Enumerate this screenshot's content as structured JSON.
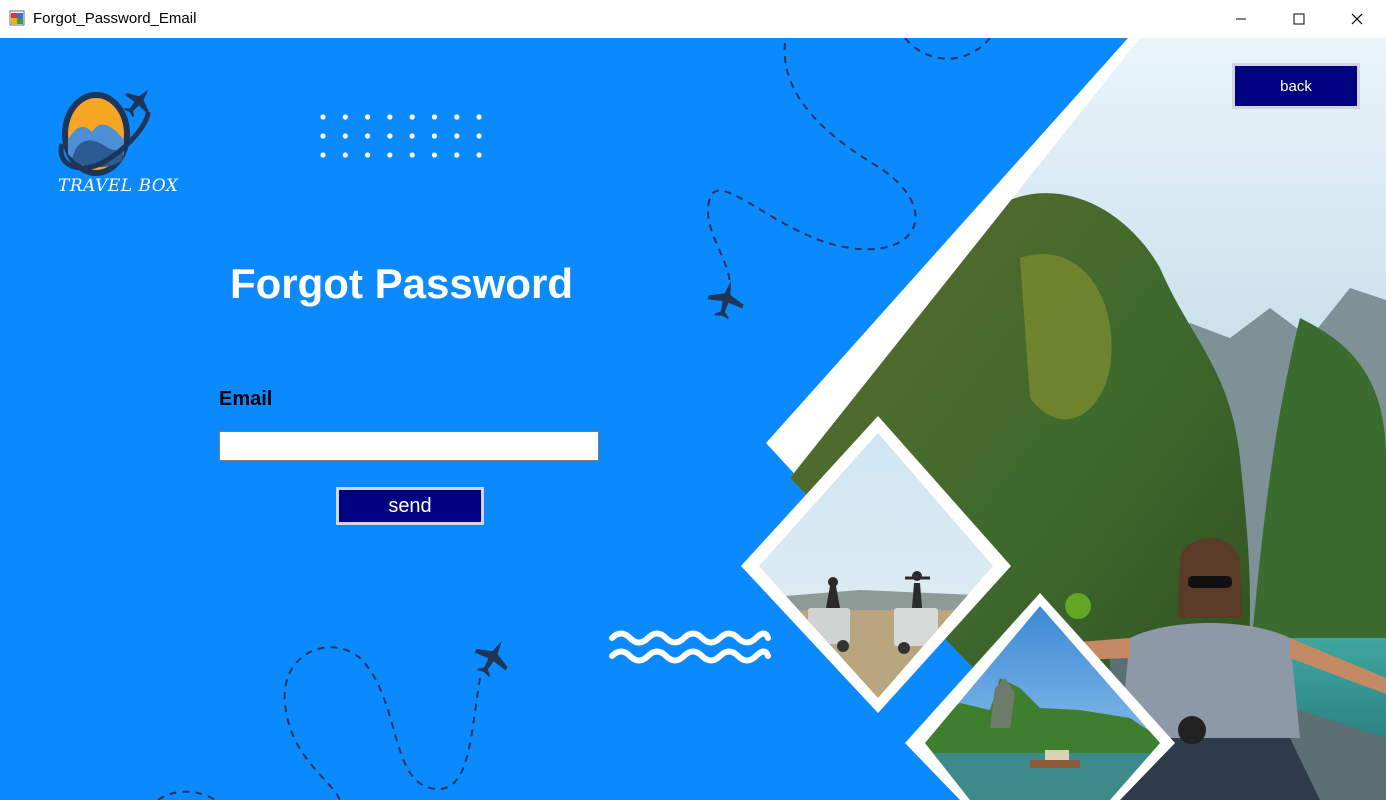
{
  "window": {
    "title": "Forgot_Password_Email",
    "app_icon": "winforms-app-icon",
    "controls": [
      "minimize-icon",
      "maximize-icon",
      "close-icon"
    ]
  },
  "logo": {
    "text": "TRAVEL BOX",
    "icon": "airplane-globe-logo"
  },
  "heading": "Forgot Password",
  "form": {
    "email_label": "Email",
    "email_value": "",
    "send_label": "send"
  },
  "nav": {
    "back_label": "back"
  },
  "colors": {
    "background": "#0b8aff",
    "button": "#000080",
    "button_border": "#cfd6e2",
    "text_light": "#ffffff",
    "dash_path": "#1c3558"
  }
}
